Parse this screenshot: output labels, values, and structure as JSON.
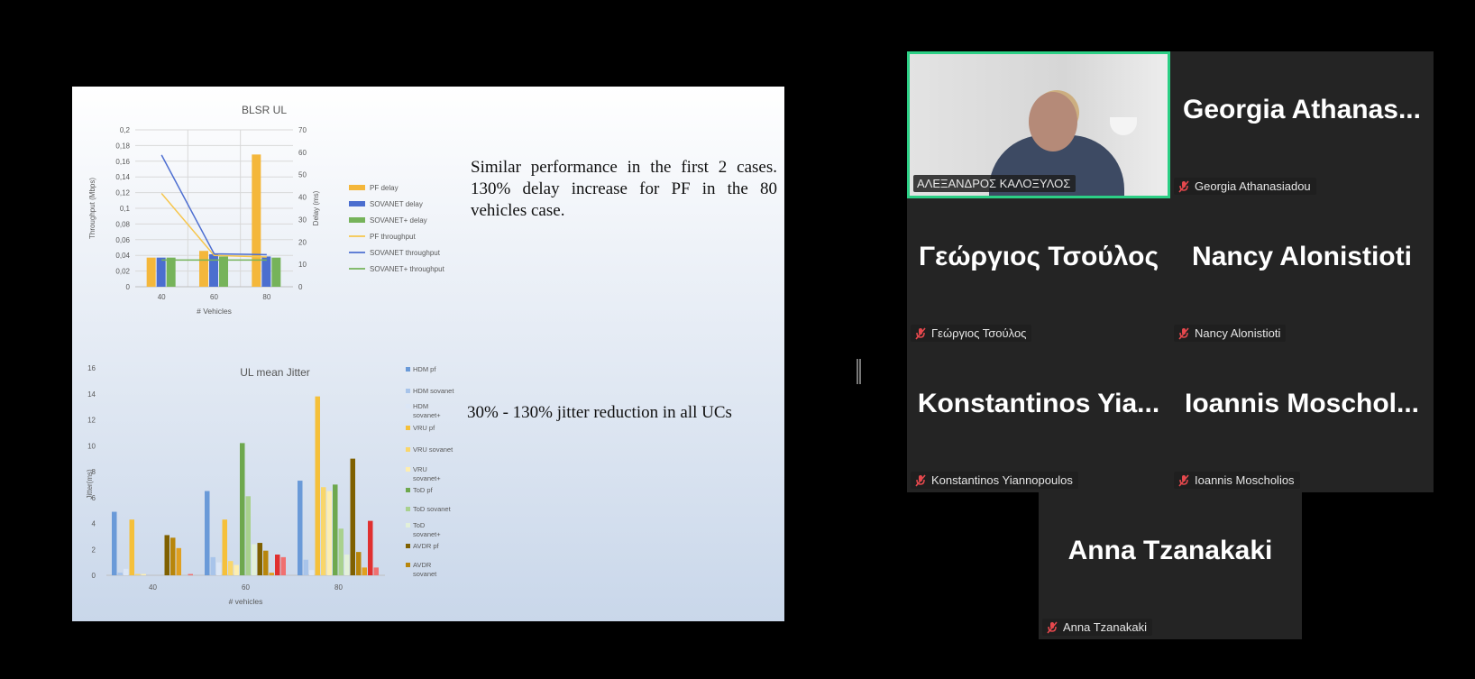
{
  "slide": {
    "chart1": {
      "title": "BLSR UL",
      "xlabel": "# Vehicles",
      "ylabel_left": "Throughput (Mbps)",
      "ylabel_right": "Delay (ms)",
      "left_ticks": [
        "0",
        "0,02",
        "0,04",
        "0,06",
        "0,08",
        "0,1",
        "0,12",
        "0,14",
        "0,16",
        "0,18",
        "0,2"
      ],
      "right_ticks": [
        "0",
        "10",
        "20",
        "30",
        "40",
        "50",
        "60",
        "70"
      ],
      "categories": [
        "40",
        "60",
        "80"
      ],
      "legend": [
        "PF delay",
        "SOVANET delay",
        "SOVANET+ delay",
        "PF throughput",
        "SOVANET throughput",
        "SOVANET+ throughput"
      ],
      "colors": {
        "pf": "#f4b73b",
        "sovanet": "#4b6ecf",
        "sovanetplus": "#76b35a",
        "pf_line": "#f6c64d",
        "sovanet_line": "#4e6fd1",
        "sovanetplus_line": "#76b35a"
      }
    },
    "chart2": {
      "title": "UL mean Jitter",
      "xlabel": "# vehicles",
      "ylabel": "Jitter(ms)",
      "y_ticks": [
        "0",
        "2",
        "4",
        "6",
        "8",
        "10",
        "12",
        "14",
        "16"
      ],
      "categories": [
        "40",
        "60",
        "80"
      ],
      "legend": [
        "HDM pf",
        "HDM sovanet",
        "HDM sovanet+",
        "VRU pf",
        "VRU sovanet",
        "VRU sovanet+",
        "ToD pf",
        "ToD sovanet",
        "ToD sovanet+",
        "AVDR pf",
        "AVDR sovanet"
      ]
    },
    "text1": "Similar performance in the first 2 cases. 130% delay increase for PF in the 80 vehicles case.",
    "text2": "30% - 130% jitter reduction in all UCs"
  },
  "chart_data": [
    {
      "type": "bar",
      "title": "BLSR UL",
      "xlabel": "# Vehicles",
      "ylabel": "Throughput (Mbps)",
      "ylabel_secondary": "Delay (ms)",
      "categories": [
        "40",
        "60",
        "80"
      ],
      "ylim": [
        0,
        0.2
      ],
      "ylim_secondary": [
        0,
        70
      ],
      "series": [
        {
          "name": "PF delay",
          "axis": "right",
          "kind": "bar",
          "values": [
            13,
            16,
            59
          ]
        },
        {
          "name": "SOVANET delay",
          "axis": "right",
          "kind": "bar",
          "values": [
            13,
            14.5,
            13.5
          ]
        },
        {
          "name": "SOVANET+ delay",
          "axis": "right",
          "kind": "bar",
          "values": [
            13,
            13.5,
            13
          ]
        },
        {
          "name": "PF throughput",
          "axis": "left",
          "kind": "line",
          "values": [
            0.119,
            0.04,
            0.038
          ]
        },
        {
          "name": "SOVANET throughput",
          "axis": "left",
          "kind": "line",
          "values": [
            0.168,
            0.042,
            0.041
          ]
        },
        {
          "name": "SOVANET+ throughput",
          "axis": "left",
          "kind": "line",
          "values": [
            0.034,
            0.034,
            0.034
          ]
        }
      ],
      "legend_position": "right",
      "grid": true
    },
    {
      "type": "bar",
      "title": "UL mean Jitter",
      "xlabel": "# vehicles",
      "ylabel": "Jitter(ms)",
      "categories": [
        "40",
        "60",
        "80"
      ],
      "ylim": [
        0,
        16
      ],
      "series": [
        {
          "name": "HDM pf",
          "values": [
            4.9,
            6.5,
            7.3
          ],
          "color": "#6a9ad8"
        },
        {
          "name": "HDM sovanet",
          "values": [
            0.2,
            1.4,
            1.2
          ],
          "color": "#a8c4ea"
        },
        {
          "name": "HDM sovanet+",
          "values": [
            0.5,
            1.0,
            0.4
          ],
          "color": "#dbe6f6"
        },
        {
          "name": "VRU pf",
          "values": [
            4.3,
            4.3,
            13.8
          ],
          "color": "#f5c03a"
        },
        {
          "name": "VRU sovanet",
          "values": [
            0.1,
            1.1,
            6.8
          ],
          "color": "#f9d66a"
        },
        {
          "name": "VRU sovanet+",
          "values": [
            0.1,
            0.8,
            6.5
          ],
          "color": "#fdeeb0"
        },
        {
          "name": "ToD pf",
          "values": [
            0,
            10.2,
            7.0
          ],
          "color": "#6ea84e"
        },
        {
          "name": "ToD sovanet",
          "values": [
            0,
            6.1,
            3.6
          ],
          "color": "#a9d18e"
        },
        {
          "name": "ToD sovanet+",
          "values": [
            0,
            2.4,
            1.6
          ],
          "color": "#e2f0d9"
        },
        {
          "name": "AVDR pf",
          "values": [
            3.1,
            2.5,
            9.0
          ],
          "color": "#7f6000"
        },
        {
          "name": "AVDR sovanet",
          "values": [
            2.9,
            1.9,
            1.8
          ],
          "color": "#b8860b"
        },
        {
          "name": "",
          "values": [
            2.1,
            0.2,
            0.6
          ],
          "color": "#e0a020"
        },
        {
          "name": "",
          "values": [
            0,
            1.6,
            4.2
          ],
          "color": "#e03030"
        },
        {
          "name": "",
          "values": [
            0.1,
            1.4,
            0.6
          ],
          "color": "#f07070"
        }
      ],
      "legend_position": "right",
      "grid": false
    }
  ],
  "participants": [
    {
      "big_name": "",
      "label": "ΑΛΕΞΑΝΔΡΟΣ ΚΑΛΟΞΥΛΟΣ",
      "video": true
    },
    {
      "big_name": "Georgia  Athanas...",
      "label": "Georgia Athanasiadou",
      "video": false
    },
    {
      "big_name": "Γεώργιος Τσούλος",
      "label": "Γεώργιος Τσούλος",
      "video": false
    },
    {
      "big_name": "Nancy Alonistioti",
      "label": "Nancy Alonistioti",
      "video": false
    },
    {
      "big_name": "Konstantinos  Yia...",
      "label": "Konstantinos Yiannopoulos",
      "video": false
    },
    {
      "big_name": "Ioannis  Moschol...",
      "label": "Ioannis Moscholios",
      "video": false
    },
    {
      "big_name": "Anna Tzanakaki",
      "label": "Anna Tzanakaki",
      "video": false
    }
  ],
  "icons": {
    "muted": "microphone-muted-icon",
    "muted_color": "#e5484d"
  }
}
